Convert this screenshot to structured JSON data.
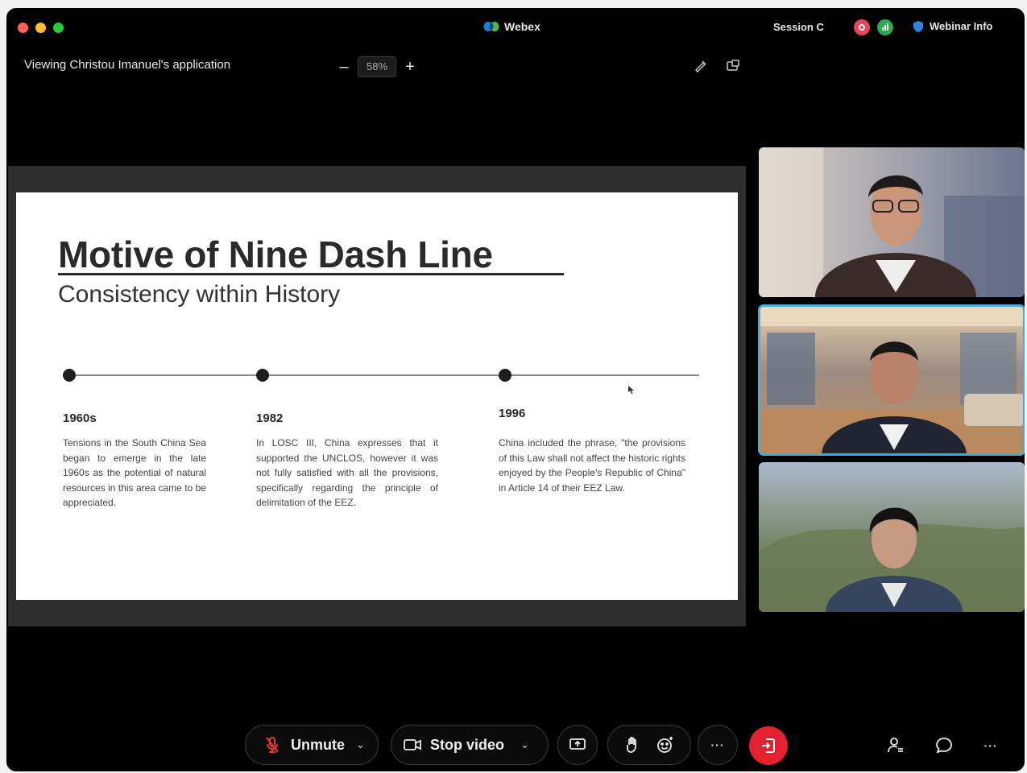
{
  "titlebar": {
    "app_name": "Webex",
    "session_label": "Session C",
    "webinar_info_label": "Webinar Info",
    "traffic_colors": [
      "#ff5f57",
      "#febc2e",
      "#28c840"
    ]
  },
  "share_bar": {
    "viewing_label": "Viewing Christou Imanuel's application",
    "zoom_out": "–",
    "zoom_level": "58%",
    "zoom_in": "+"
  },
  "slide": {
    "title": "Motive of Nine Dash Line",
    "subtitle": "Consistency within History",
    "timeline": [
      {
        "year": "1960s",
        "text": "Tensions in the South China Sea began to emerge in the late 1960s as the potential of natural resources in this area came to be appreciated."
      },
      {
        "year": "1982",
        "text": "In LOSC III, China expresses that it supported the UNCLOS, however it was not fully satisfied with all the provisions, specifically regarding the principle of delimitation of the EEZ."
      },
      {
        "year": "1996",
        "text": "China included the phrase, \"the provisions of this Law shall not affect the historic rights enjoyed by the People's Republic of China\" in Article 14 of their EEZ Law."
      }
    ]
  },
  "controls": {
    "unmute_label": "Unmute",
    "stop_video_label": "Stop video",
    "more_label": "···",
    "leave_color": "#e2222e",
    "accent_color": "#4aa8d8"
  }
}
